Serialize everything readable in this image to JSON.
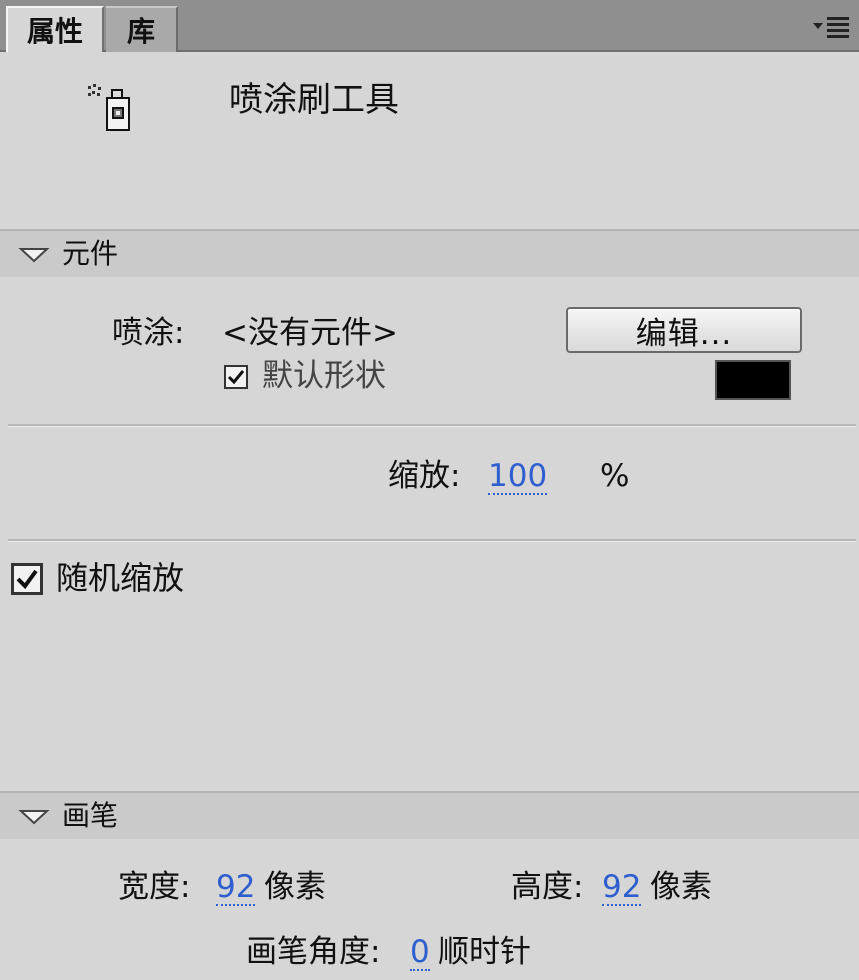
{
  "tabs": [
    {
      "label": "属性",
      "active": true
    },
    {
      "label": "库",
      "active": false
    }
  ],
  "menu": {
    "icon": "panel-menu-icon"
  },
  "tool": {
    "name": "喷涂刷工具",
    "icon": "spray-brush-icon"
  },
  "symbol_section": {
    "title": "元件",
    "spray_label": "喷涂:",
    "spray_value": "<没有元件>",
    "edit_button": "编辑...",
    "default_shape_label": "默认形状",
    "default_shape_checked": true,
    "color": "#000000"
  },
  "scale": {
    "label": "缩放:",
    "value": "100",
    "unit": "%"
  },
  "random_scale": {
    "label": "随机缩放",
    "checked": true
  },
  "brush_section": {
    "title": "画笔",
    "width_label": "宽度:",
    "width_value": "92",
    "width_unit": "像素",
    "height_label": "高度:",
    "height_value": "92",
    "height_unit": "像素",
    "angle_label": "画笔角度:",
    "angle_value": "0",
    "angle_unit": "顺时针"
  },
  "colors": {
    "panel_bg": "#d6d6d6",
    "tabbar_bg": "#8f8f8f",
    "link_blue": "#2f5fcf"
  }
}
